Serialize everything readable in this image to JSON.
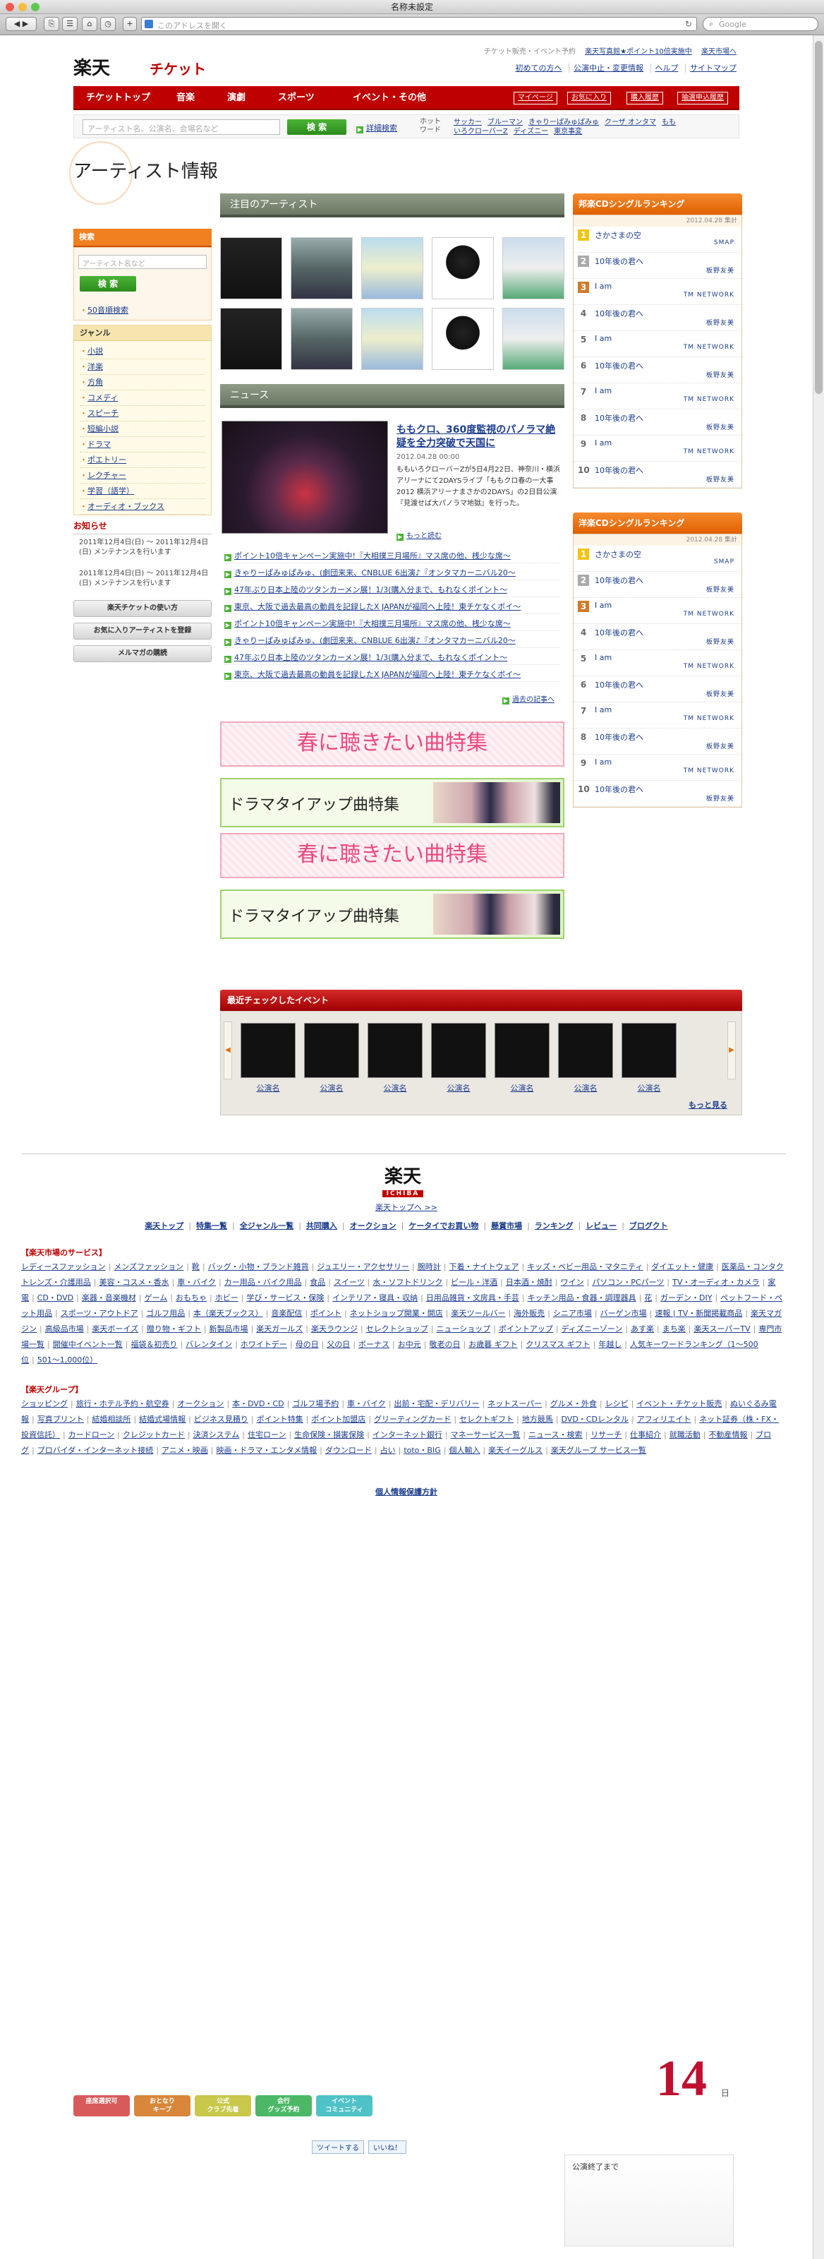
{
  "browser": {
    "window_title": "名称未設定",
    "url_placeholder": "このアドレスを開く",
    "search_placeholder": "Google"
  },
  "header": {
    "logo_text": "楽天",
    "logo_sub": "チケット",
    "top_links": [
      "チケット販売・イベント予約",
      "楽天写真館★ポイント10倍実施中",
      "楽天市場へ"
    ],
    "sub_links": [
      "初めての方へ",
      "公演中止・変更情報",
      "ヘルプ",
      "サイトマップ"
    ]
  },
  "gnav": {
    "items": [
      "チケットトップ",
      "音楽",
      "演劇",
      "スポーツ",
      "イベント・その他"
    ],
    "right_items": [
      "マイページ",
      "お気に入り",
      "購入履歴",
      "抽選申込履歴"
    ]
  },
  "search": {
    "placeholder": "アーティスト名、公演名、会場名など",
    "button": "検 索",
    "detail": "詳細検索",
    "hotword_label": "ホットワード",
    "hotwords": [
      "サッカー",
      "ブルーマン",
      "きゃりーぱみゅぱみゅ",
      "クーザ オンタマ",
      "もも",
      "いろクローバーZ",
      "ディズニー",
      "東京事変"
    ]
  },
  "page_title": "アーティスト情報",
  "left": {
    "search_title": "検索",
    "artist_placeholder": "アーティスト名など",
    "search_button": "検 索",
    "fifty": "50音順検索",
    "genre_title": "ジャンル",
    "genres": [
      "小説",
      "洋楽",
      "方角",
      "コメディ",
      "スピーチ",
      "短編小説",
      "ドラマ",
      "ポエトリー",
      "レクチャー",
      "学習（語学）",
      "オーディオ・ブックス"
    ],
    "notice_title": "お知らせ",
    "notices": [
      "2011年12月4日(日) 〜 2011年12月4日(日) メンテナンスを行います",
      "2011年12月4日(日) 〜 2011年12月4日(日) メンテナンスを行います"
    ],
    "buttons": [
      "楽天チケットの使い方",
      "お気に入りアーティストを登録",
      "メルマガの購読"
    ]
  },
  "center": {
    "featured_title": "注目のアーティスト",
    "news_title": "ニュース",
    "news_headline": "ももクロ、360度監視のパノラマ絶疑を全力突破で天国に",
    "news_date": "2012.04.28 00:00",
    "news_body": "ももいろクローバーZが5日4月22日、神奈川・横浜アリーナにて2DAYSライブ「ももクロ春の一大事2012 横浜アリーナまさかの2DAYS」の2日目公演『見渡せば大パノラマ地獄』を行った。",
    "news_more": "もっと読む",
    "news_items": [
      "ポイント10倍キャンペーン実施中!『大相撲三月場所』マス席の他、桟少な席〜",
      "きゃりーぱみゅぱみゅ、(劇団来来、CNBLUE 6出演♪『オンタマカーニバル20〜",
      "47年ぶり日本上陸のツタンカーメン展！1/3(購入分まで、もれなくポイント〜",
      "東京、大阪で過去最高の動員を記録したX JAPANが福岡へ上陸！東チケなくボイ〜",
      "ポイント10倍キャンペーン実施中!『大相撲三月場所』マス席の他、桟少な席〜",
      "きゃりーぱみゅぱみゅ、(劇団来来、CNBLUE 6出演♪『オンタマカーニバル20〜",
      "47年ぶり日本上陸のツタンカーメン展！1/3(購入分まで、もれなくポイント〜",
      "東京、大阪で過去最高の動員を記録したX JAPANが福岡へ上陸！東チケなくボイ〜"
    ],
    "past_news": "過去の記事へ",
    "banner_spring": "春に聴きたい曲特集",
    "banner_drama": "ドラマタイアップ曲特集",
    "recent_title": "最近チェックしたイベント",
    "recent_label": "公演名",
    "see_more": "もっと見る"
  },
  "ranking_jp": {
    "title": "邦楽CDシングルランキング",
    "date": "2012.04.28 集計",
    "items": [
      {
        "rank": "1",
        "song": "さかさまの空",
        "artist": "SMAP"
      },
      {
        "rank": "2",
        "song": "10年後の君へ",
        "artist": "板野友美"
      },
      {
        "rank": "3",
        "song": "I am",
        "artist": "TM NETWORK"
      },
      {
        "rank": "4",
        "song": "10年後の君へ",
        "artist": "板野友美"
      },
      {
        "rank": "5",
        "song": "I am",
        "artist": "TM NETWORK"
      },
      {
        "rank": "6",
        "song": "10年後の君へ",
        "artist": "板野友美"
      },
      {
        "rank": "7",
        "song": "I am",
        "artist": "TM NETWORK"
      },
      {
        "rank": "8",
        "song": "10年後の君へ",
        "artist": "板野友美"
      },
      {
        "rank": "9",
        "song": "I am",
        "artist": "TM NETWORK"
      },
      {
        "rank": "10",
        "song": "10年後の君へ",
        "artist": "板野友美"
      }
    ]
  },
  "ranking_west": {
    "title": "洋楽CDシングルランキング",
    "date": "2012.04.28 集計",
    "items": [
      {
        "rank": "1",
        "song": "さかさまの空",
        "artist": "SMAP"
      },
      {
        "rank": "2",
        "song": "10年後の君へ",
        "artist": "板野友美"
      },
      {
        "rank": "3",
        "song": "I am",
        "artist": "TM NETWORK"
      },
      {
        "rank": "4",
        "song": "10年後の君へ",
        "artist": "板野友美"
      },
      {
        "rank": "5",
        "song": "I am",
        "artist": "TM NETWORK"
      },
      {
        "rank": "6",
        "song": "10年後の君へ",
        "artist": "板野友美"
      },
      {
        "rank": "7",
        "song": "I am",
        "artist": "TM NETWORK"
      },
      {
        "rank": "8",
        "song": "10年後の君へ",
        "artist": "板野友美"
      },
      {
        "rank": "9",
        "song": "I am",
        "artist": "TM NETWORK"
      },
      {
        "rank": "10",
        "song": "10年後の君へ",
        "artist": "板野友美"
      }
    ]
  },
  "footer": {
    "logo": "楽天",
    "logo_sub": "ICHIBA",
    "top_link": "楽天トップへ >>",
    "nav": [
      "楽天トップ",
      "特集一覧",
      "全ジャンル一覧",
      "共同購入",
      "オークション",
      "ケータイでお買い物",
      "懸賞市場",
      "ランキング",
      "レビュー",
      "ブログクト"
    ],
    "market_title": "【楽天市場のサービス】",
    "market_links": [
      "レディースファッション",
      "メンズファッション",
      "靴",
      "バッグ・小物・ブランド雑貨",
      "ジュエリー・アクセサリー",
      "腕時計",
      "下着・ナイトウェア",
      "キッズ・ベビー用品・マタニティ",
      "ダイエット・健康",
      "医薬品・コンタクトレンズ・介護用品",
      "美容・コスメ・香水",
      "車・バイク",
      "カー用品・バイク用品",
      "食品",
      "スイーツ",
      "水・ソフトドリンク",
      "ビール・洋酒",
      "日本酒・焼酎",
      "ワイン",
      "パソコン・PCパーツ",
      "TV・オーディオ・カメラ",
      "家電",
      "CD・DVD",
      "楽器・音楽機材",
      "ゲーム",
      "おもちゃ",
      "ホビー",
      "学び・サービス・保険",
      "インテリア・寝具・収納",
      "日用品雑貨・文房具・手芸",
      "キッチン用品・食器・調理器具",
      "花",
      "ガーデン・DIY",
      "ペットフード・ペット用品",
      "スポーツ・アウトドア",
      "ゴルフ用品",
      "本（楽天ブックス）",
      "音楽配信",
      "ポイント",
      "ネットショップ開業・開店",
      "楽天ツールバー",
      "海外販売",
      "シニア市場",
      "バーゲン市場",
      "速報 | TV・新聞掲載商品",
      "楽天マガジン",
      "高級品市場",
      "楽天ボーイズ",
      "贈り物・ギフト",
      "新製品市場",
      "楽天ガールズ",
      "楽天ラウンジ",
      "セレクトショップ",
      "ニューショップ",
      "ポイントアップ",
      "ディズニーゾーン",
      "あす楽",
      "まち楽",
      "楽天スーパーTV",
      "専門市場一覧",
      "開催中イベント一覧",
      "福袋＆初売り",
      "バレンタイン",
      "ホワイトデー",
      "母の日",
      "父の日",
      "ボーナス",
      "お中元",
      "敬老の日",
      "お歳暮 ギフト",
      "クリスマス ギフト",
      "年越し",
      "人気キーワードランキング（1〜500位",
      "501〜1,000位）"
    ],
    "group_title": "【楽天グループ】",
    "group_links": [
      "ショッピング",
      "旅行・ホテル予約・航空券",
      "オークション",
      "本・DVD・CD",
      "ゴルフ場予約",
      "車・バイク",
      "出前・宅配・デリバリー",
      "ネットスーパー",
      "グルメ・外食",
      "レシピ",
      "イベント・チケット販売",
      "ぬいぐるみ電報",
      "写真プリント",
      "結婚相談所",
      "結婚式場情報",
      "ビジネス見積り",
      "ポイント特集",
      "ポイント加盟店",
      "グリーティングカード",
      "セレクトギフト",
      "地方競馬",
      "DVD・CDレンタル",
      "アフィリエイト",
      "ネット証券（株・FX・投資信託）",
      "カードローン",
      "クレジットカード",
      "決済システム",
      "住宅ローン",
      "生命保険・損害保険",
      "インターネット銀行",
      "マネーサービス一覧",
      "ニュース・検索",
      "リサーチ",
      "仕事紹介",
      "就職活動",
      "不動産情報",
      "ブログ",
      "プロバイダ・インターネット接続",
      "アニメ・映画",
      "映画・ドラマ・エンタメ情報",
      "ダウンロード",
      "占い",
      "toto・BIG",
      "個人輸入",
      "楽天イーグルス",
      "楽天グループ サービス一覧"
    ],
    "privacy": "個人情報保護方針",
    "badges": [
      "座席選択可",
      "おとなり\nキープ",
      "公式\nクラブ先着",
      "会行\nグッズ予約",
      "イベント\nコミュニティ"
    ],
    "badge_colors": [
      "#d95a5a",
      "#d8873a",
      "#c8c84a",
      "#4cb866",
      "#4fc2c8"
    ],
    "countdown_number": "14",
    "countdown_unit": "日",
    "tweet": "ツイートする",
    "like": "いいね！",
    "end_label": "公演終了まで"
  }
}
